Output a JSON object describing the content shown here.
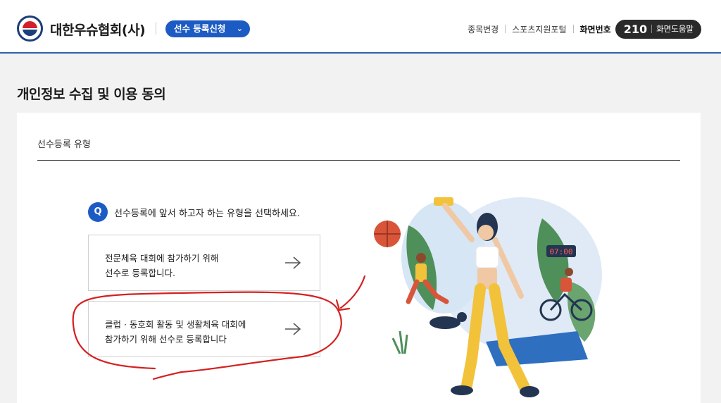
{
  "header": {
    "org_name": "대한우슈협회(사)",
    "menu_pill_label": "선수 등록신청",
    "links": [
      "종목변경",
      "스포츠지원포털"
    ],
    "screen_label": "화면번호",
    "screen_number": "210",
    "help_label": "화면도움말"
  },
  "page": {
    "title": "개인정보 수집 및 이용 동의",
    "section_label": "선수등록 유형",
    "question_badge": "Q",
    "question": "선수등록에 앞서 하고자 하는 유형을 선택하세요.",
    "options": [
      {
        "line1": "전문체육 대회에 참가하기 위해",
        "line2": "선수로 등록합니다."
      },
      {
        "line1": "클럽 · 동호회 활동 및 생활체육 대회에",
        "line2": "참가하기 위해 선수로 등록합니다"
      }
    ]
  },
  "illustration": {
    "clock_text": "07:00"
  },
  "colors": {
    "primary": "#1d5bc4",
    "header_border": "#2f5fa8",
    "badge_dark": "#2a2a2a",
    "annotation_red": "#d42020"
  }
}
